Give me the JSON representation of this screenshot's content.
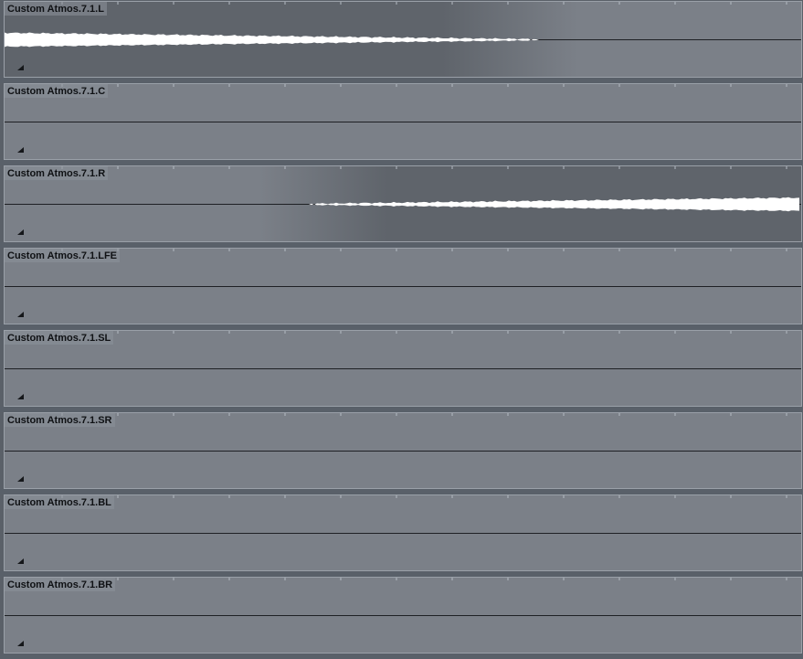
{
  "tracks": [
    {
      "name": "Custom Atmos.7.1.L",
      "signal": "fade-out"
    },
    {
      "name": "Custom Atmos.7.1.C",
      "signal": "silent"
    },
    {
      "name": "Custom Atmos.7.1.R",
      "signal": "fade-in"
    },
    {
      "name": "Custom Atmos.7.1.LFE",
      "signal": "silent"
    },
    {
      "name": "Custom Atmos.7.1.SL",
      "signal": "silent"
    },
    {
      "name": "Custom Atmos.7.1.SR",
      "signal": "silent"
    },
    {
      "name": "Custom Atmos.7.1.BL",
      "signal": "silent"
    },
    {
      "name": "Custom Atmos.7.1.BR",
      "signal": "silent"
    }
  ],
  "colors": {
    "lane_bg": "#7b8088",
    "waveform": "#ffffff",
    "baseline": "#1e2024",
    "active_shade": "#5f646b"
  },
  "icons": {
    "fold": "triangle-corner-icon"
  }
}
